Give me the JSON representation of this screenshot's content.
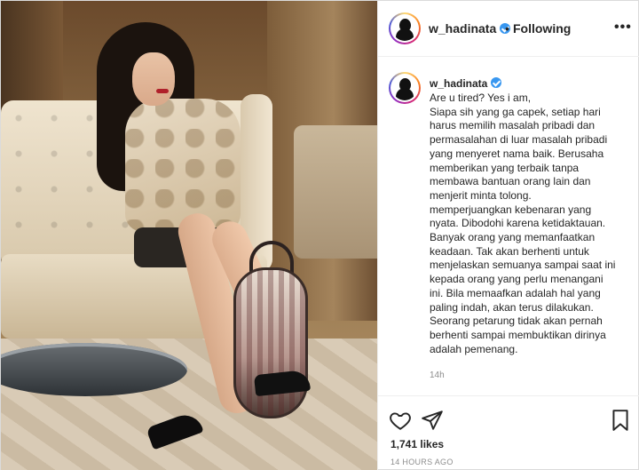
{
  "post": {
    "username": "w_hadinata",
    "follow_status": "Following",
    "separator": "•",
    "more_label": "•••",
    "caption_lines": [
      "Are u tired? Yes i am,",
      "Siapa sih yang ga capek, setiap hari",
      "harus memilih masalah pribadi dan",
      "permasalahan di luar masalah pribadi",
      "yang menyeret nama baik. Berusaha",
      "memberikan yang terbaik tanpa",
      "membawa bantuan orang lain dan",
      "menjerit minta tolong.",
      "memperjuangkan kebenaran yang",
      "nyata. Dibodohi karena ketidaktauan.",
      "Banyak orang yang memanfaatkan",
      "keadaan. Tak akan berhenti untuk",
      "menjelaskan semuanya sampai saat ini",
      "kepada orang yang perlu menangani",
      "ini. Bila memaafkan adalah hal yang",
      "paling indah, akan terus dilakukan.",
      "Seorang petarung tidak akan pernah",
      "berhenti sampai membuktikan dirinya",
      "adalah pemenang."
    ],
    "caption_age": "14h",
    "likes": "1,741 likes",
    "timestamp": "14 HOURS AGO"
  },
  "icons": {
    "verified": "verified-badge-icon",
    "like": "heart-icon",
    "share": "paper-plane-icon",
    "save": "bookmark-icon",
    "more": "more-options-icon"
  },
  "colors": {
    "verified_blue": "#3897f0",
    "text": "#262626",
    "muted": "#8e8e8e",
    "border": "#efefef"
  }
}
